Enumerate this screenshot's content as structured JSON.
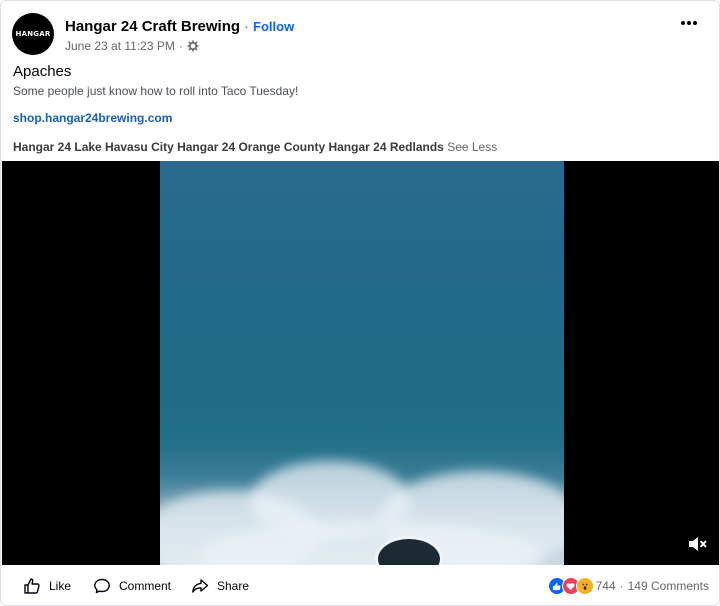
{
  "post": {
    "page_name": "Hangar 24 Craft Brewing",
    "follow_label": "Follow",
    "avatar_text": "HANGAR",
    "date": "June 23 at 11:23 PM",
    "title": "Apaches",
    "text": "Some people just know how to roll into Taco Tuesday!",
    "link": "shop.hangar24brewing.com",
    "tags": [
      "Hangar 24 Lake Havasu City",
      "Hangar 24 Orange County",
      "Hangar 24 Redlands"
    ],
    "see_less": "See Less"
  },
  "actions": {
    "like": "Like",
    "comment": "Comment",
    "share": "Share"
  },
  "stats": {
    "reaction_count": "744",
    "comments": "149 Comments",
    "reactions": [
      "like",
      "love",
      "wow"
    ]
  },
  "icons": {
    "more": "more-options-icon",
    "privacy": "globe-gear-icon",
    "mute": "speaker-muted-icon"
  },
  "colors": {
    "link": "#1a5fb4",
    "follow": "#0866ff",
    "like_reaction": "#0866ff",
    "love_reaction": "#f33e58",
    "wow_reaction": "#f7b125"
  }
}
